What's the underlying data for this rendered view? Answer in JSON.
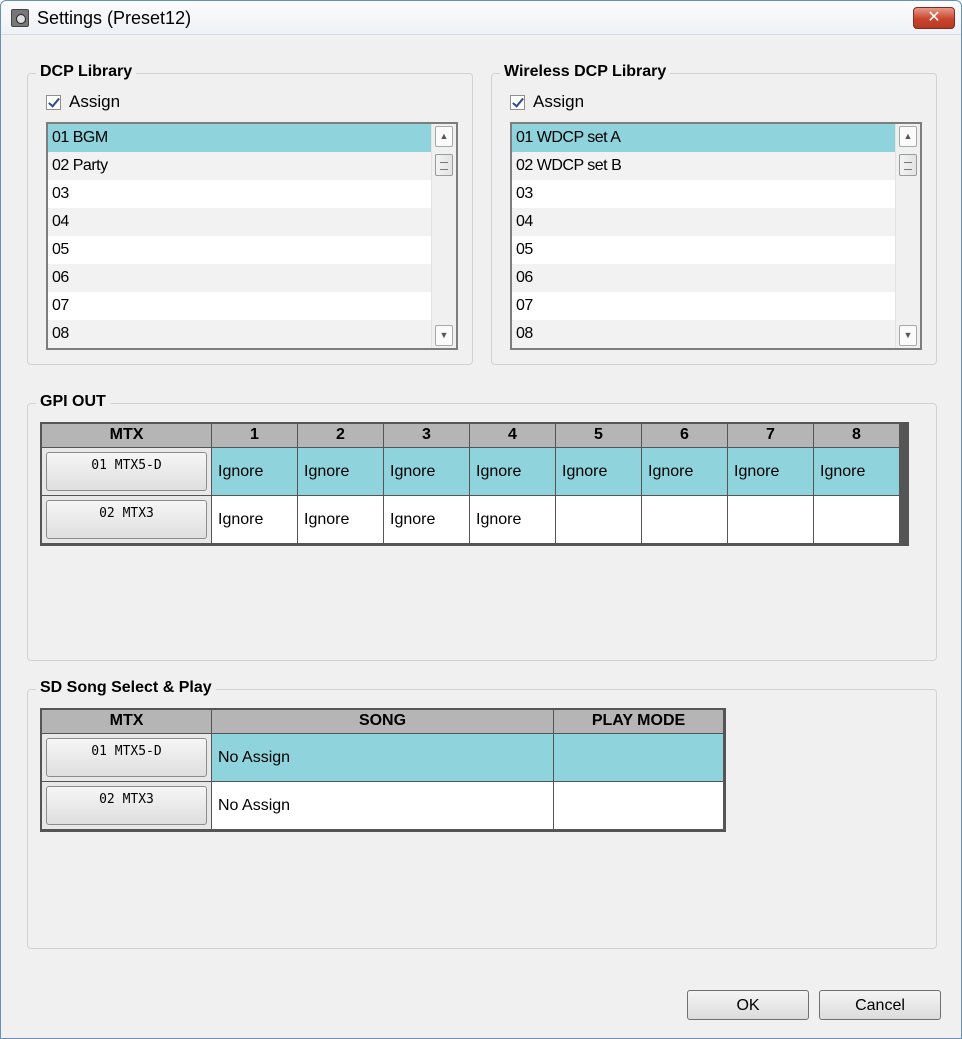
{
  "window": {
    "title": "Settings (Preset12)",
    "close_glyph": "✕"
  },
  "dcp_library": {
    "legend": "DCP Library",
    "assign_label": "Assign",
    "assign_checked": true,
    "items": [
      "01 BGM",
      "02 Party",
      "03",
      "04",
      "05",
      "06",
      "07",
      "08"
    ],
    "selected": 0
  },
  "wireless_dcp_library": {
    "legend": "Wireless DCP Library",
    "assign_label": "Assign",
    "assign_checked": true,
    "items": [
      "01 WDCP set A",
      "02 WDCP set B",
      "03",
      "04",
      "05",
      "06",
      "07",
      "08"
    ],
    "selected": 0
  },
  "gpi_out": {
    "legend": "GPI OUT",
    "headers": [
      "MTX",
      "1",
      "2",
      "3",
      "4",
      "5",
      "6",
      "7",
      "8"
    ],
    "rows": [
      {
        "mtx": "01 MTX5-D",
        "cells": [
          "Ignore",
          "Ignore",
          "Ignore",
          "Ignore",
          "Ignore",
          "Ignore",
          "Ignore",
          "Ignore"
        ]
      },
      {
        "mtx": "02 MTX3",
        "cells": [
          "Ignore",
          "Ignore",
          "Ignore",
          "Ignore",
          "",
          "",
          "",
          ""
        ]
      }
    ]
  },
  "sd_song": {
    "legend": "SD Song Select & Play",
    "headers": [
      "MTX",
      "SONG",
      "PLAY MODE"
    ],
    "rows": [
      {
        "mtx": "01 MTX5-D",
        "song": "No Assign",
        "play_mode": ""
      },
      {
        "mtx": "02 MTX3",
        "song": "No Assign",
        "play_mode": ""
      }
    ]
  },
  "buttons": {
    "ok": "OK",
    "cancel": "Cancel"
  },
  "colors": {
    "selection": "#8fd3dc",
    "header": "#b5b5b5",
    "close": "#c9442c"
  },
  "icons": {
    "app": "app-settings-icon",
    "close": "close-icon",
    "scroll_up": "scroll-up-arrow-icon",
    "scroll_down": "scroll-down-arrow-icon"
  }
}
